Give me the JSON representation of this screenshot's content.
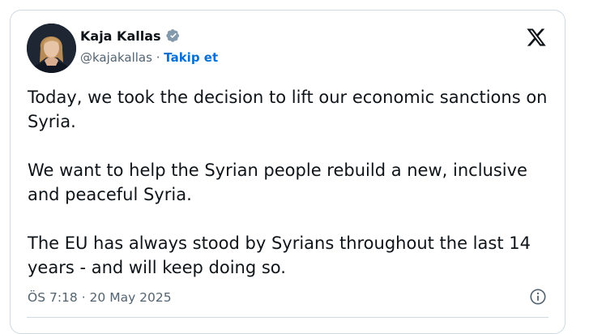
{
  "author": {
    "name": "Kaja Kallas",
    "handle": "@kajakallas",
    "separator": "·",
    "follow_label": "Takip et"
  },
  "icons": {
    "verified": "verified-badge-icon",
    "platform": "x-logo-icon",
    "info": "info-icon"
  },
  "tweet": {
    "paragraphs": [
      "Today, we took the decision to lift our economic sanctions on Syria.",
      "We want to help the Syrian people rebuild a new, inclusive and peaceful Syria.",
      "The EU has always stood by Syrians throughout the last 14 years - and will keep doing so."
    ],
    "timestamp": "ÖS 7:18 · 20 May 2025"
  },
  "colors": {
    "text": "#0f1419",
    "secondary": "#536471",
    "link": "#006fd6",
    "verified_badge": "#829aab",
    "border": "#cfd9de"
  }
}
